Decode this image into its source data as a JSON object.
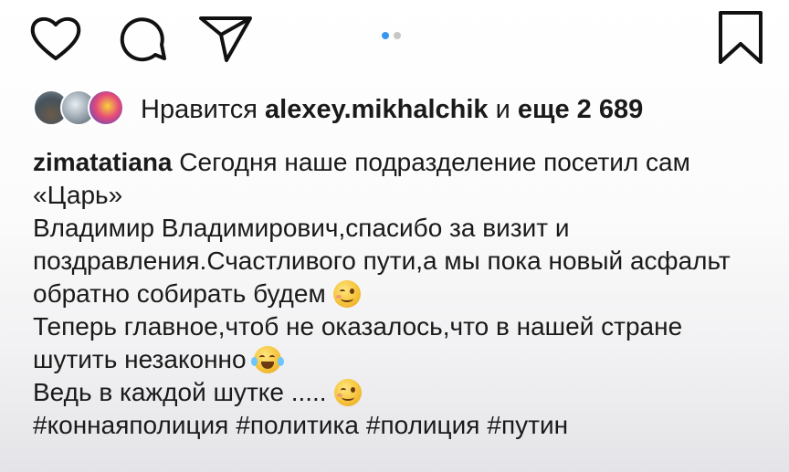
{
  "actions": {
    "icons": [
      "heart-icon",
      "comment-icon",
      "share-icon",
      "bookmark-icon"
    ],
    "carousel": {
      "count": 2,
      "active_index": 0,
      "active_color": "#3897f0",
      "inactive_color": "#c7c7c7"
    }
  },
  "likes": {
    "prefix": "Нравится",
    "user": "alexey.mikhalchik",
    "middle": "и",
    "count": "еще 2 689"
  },
  "caption": {
    "author": "zimatatiana",
    "line1_text": "Сегодня наше подразделение посетил сам «Царь»",
    "line2_text": "Владимир Владимирович,спасибо за визит и поздравления.Счастливого пути,а мы пока новый асфальт обратно собирать будем",
    "line3_text": "Теперь главное,чтоб не оказалось,что в нашей стране шутить незаконно",
    "line4_text": "Ведь в каждой шутке .....",
    "emojis": [
      "wink-tongue-emoji",
      "tears-of-joy-emoji",
      "wink-emoji"
    ],
    "hashtags": [
      "#коннаяполиция",
      "#политика",
      "#полиция",
      "#путин"
    ]
  }
}
